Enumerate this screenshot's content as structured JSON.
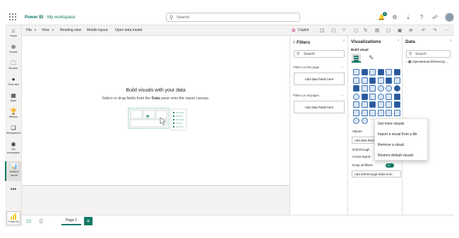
{
  "topbar": {
    "app_title": "Power BI",
    "workspace": "My workspace",
    "search_placeholder": "Search",
    "notification_count": "3",
    "icons": [
      "apps-waffle-icon",
      "notification-icon",
      "settings-icon",
      "download-icon",
      "help-icon",
      "share-icon",
      "user-avatar"
    ]
  },
  "leftnav": {
    "items": [
      {
        "label": "Home",
        "icon": "home-icon"
      },
      {
        "label": "Create",
        "icon": "create-icon"
      },
      {
        "label": "Browse",
        "icon": "browse-icon"
      },
      {
        "label": "OneLake",
        "icon": "onelake-icon"
      },
      {
        "label": "Apps",
        "icon": "apps-icon"
      },
      {
        "label": "Metrics",
        "icon": "metrics-icon"
      },
      {
        "label": "Workspaces",
        "icon": "workspaces-icon"
      },
      {
        "label": "My workspace",
        "icon": "my-workspace-icon"
      },
      {
        "label": "Untitled report",
        "icon": "report-icon"
      }
    ],
    "more": "•••",
    "bottom_label": "Power BI"
  },
  "ribbon": {
    "file": "File",
    "view": "View",
    "reading_view": "Reading view",
    "mobile_layout": "Mobile layout",
    "open_data_model": "Open data model",
    "copilot": "Copilot"
  },
  "canvas": {
    "title": "Build visuals with your data",
    "subtitle_pre": "Select or drag fields from the ",
    "subtitle_bold": "Data",
    "subtitle_post": " pane onto the report canvas."
  },
  "bottombar": {
    "page_tab": "Page 1",
    "add_page": "+"
  },
  "filters": {
    "title": "Filters",
    "search_placeholder": "Search",
    "on_this_page": "Filters on this page",
    "on_all_pages": "Filters on all pages",
    "add_data_fields": "Add data fields here",
    "more": "..."
  },
  "visualizations": {
    "title": "Visualizations",
    "build_visual": "Build visual",
    "values": "Values",
    "add_data_field": "Add data fields here",
    "drill_through": "Drill through",
    "cross_report": "Cross-report",
    "keep_all_filters": "Keep all filters",
    "toggle_state": "On",
    "add_drill_through": "Add drill-through fields here",
    "more": "..."
  },
  "context_menu": {
    "items": [
      "Get more visuals",
      "Import a visual from a file",
      "Remove a visual",
      "Restore default visuals"
    ]
  },
  "data": {
    "title": "Data",
    "search_placeholder": "Search",
    "table": "Operational Efficiency ..."
  },
  "colors": {
    "brand": "#117865",
    "visual_blue": "#3a72b5",
    "panel_gray": "#f3f2f1"
  }
}
